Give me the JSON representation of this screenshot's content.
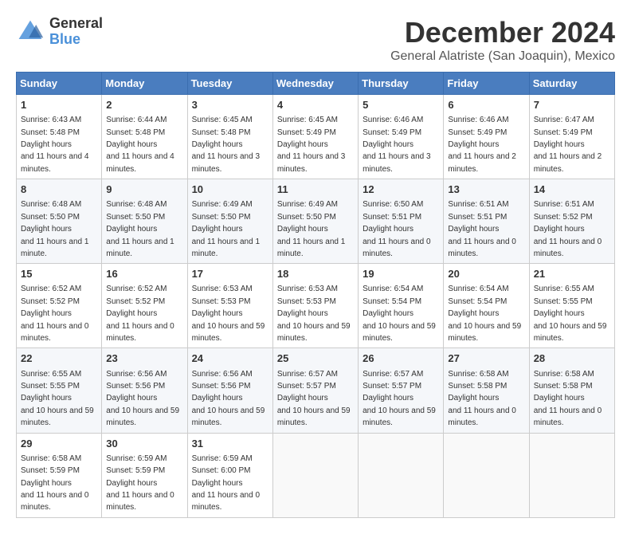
{
  "logo": {
    "general": "General",
    "blue": "Blue"
  },
  "title": {
    "month": "December 2024",
    "location": "General Alatriste (San Joaquin), Mexico"
  },
  "weekdays": [
    "Sunday",
    "Monday",
    "Tuesday",
    "Wednesday",
    "Thursday",
    "Friday",
    "Saturday"
  ],
  "weeks": [
    [
      {
        "day": "1",
        "sunrise": "6:43 AM",
        "sunset": "5:48 PM",
        "daylight": "11 hours and 4 minutes."
      },
      {
        "day": "2",
        "sunrise": "6:44 AM",
        "sunset": "5:48 PM",
        "daylight": "11 hours and 4 minutes."
      },
      {
        "day": "3",
        "sunrise": "6:45 AM",
        "sunset": "5:48 PM",
        "daylight": "11 hours and 3 minutes."
      },
      {
        "day": "4",
        "sunrise": "6:45 AM",
        "sunset": "5:49 PM",
        "daylight": "11 hours and 3 minutes."
      },
      {
        "day": "5",
        "sunrise": "6:46 AM",
        "sunset": "5:49 PM",
        "daylight": "11 hours and 3 minutes."
      },
      {
        "day": "6",
        "sunrise": "6:46 AM",
        "sunset": "5:49 PM",
        "daylight": "11 hours and 2 minutes."
      },
      {
        "day": "7",
        "sunrise": "6:47 AM",
        "sunset": "5:49 PM",
        "daylight": "11 hours and 2 minutes."
      }
    ],
    [
      {
        "day": "8",
        "sunrise": "6:48 AM",
        "sunset": "5:50 PM",
        "daylight": "11 hours and 1 minute."
      },
      {
        "day": "9",
        "sunrise": "6:48 AM",
        "sunset": "5:50 PM",
        "daylight": "11 hours and 1 minute."
      },
      {
        "day": "10",
        "sunrise": "6:49 AM",
        "sunset": "5:50 PM",
        "daylight": "11 hours and 1 minute."
      },
      {
        "day": "11",
        "sunrise": "6:49 AM",
        "sunset": "5:50 PM",
        "daylight": "11 hours and 1 minute."
      },
      {
        "day": "12",
        "sunrise": "6:50 AM",
        "sunset": "5:51 PM",
        "daylight": "11 hours and 0 minutes."
      },
      {
        "day": "13",
        "sunrise": "6:51 AM",
        "sunset": "5:51 PM",
        "daylight": "11 hours and 0 minutes."
      },
      {
        "day": "14",
        "sunrise": "6:51 AM",
        "sunset": "5:52 PM",
        "daylight": "11 hours and 0 minutes."
      }
    ],
    [
      {
        "day": "15",
        "sunrise": "6:52 AM",
        "sunset": "5:52 PM",
        "daylight": "11 hours and 0 minutes."
      },
      {
        "day": "16",
        "sunrise": "6:52 AM",
        "sunset": "5:52 PM",
        "daylight": "11 hours and 0 minutes."
      },
      {
        "day": "17",
        "sunrise": "6:53 AM",
        "sunset": "5:53 PM",
        "daylight": "10 hours and 59 minutes."
      },
      {
        "day": "18",
        "sunrise": "6:53 AM",
        "sunset": "5:53 PM",
        "daylight": "10 hours and 59 minutes."
      },
      {
        "day": "19",
        "sunrise": "6:54 AM",
        "sunset": "5:54 PM",
        "daylight": "10 hours and 59 minutes."
      },
      {
        "day": "20",
        "sunrise": "6:54 AM",
        "sunset": "5:54 PM",
        "daylight": "10 hours and 59 minutes."
      },
      {
        "day": "21",
        "sunrise": "6:55 AM",
        "sunset": "5:55 PM",
        "daylight": "10 hours and 59 minutes."
      }
    ],
    [
      {
        "day": "22",
        "sunrise": "6:55 AM",
        "sunset": "5:55 PM",
        "daylight": "10 hours and 59 minutes."
      },
      {
        "day": "23",
        "sunrise": "6:56 AM",
        "sunset": "5:56 PM",
        "daylight": "10 hours and 59 minutes."
      },
      {
        "day": "24",
        "sunrise": "6:56 AM",
        "sunset": "5:56 PM",
        "daylight": "10 hours and 59 minutes."
      },
      {
        "day": "25",
        "sunrise": "6:57 AM",
        "sunset": "5:57 PM",
        "daylight": "10 hours and 59 minutes."
      },
      {
        "day": "26",
        "sunrise": "6:57 AM",
        "sunset": "5:57 PM",
        "daylight": "10 hours and 59 minutes."
      },
      {
        "day": "27",
        "sunrise": "6:58 AM",
        "sunset": "5:58 PM",
        "daylight": "11 hours and 0 minutes."
      },
      {
        "day": "28",
        "sunrise": "6:58 AM",
        "sunset": "5:58 PM",
        "daylight": "11 hours and 0 minutes."
      }
    ],
    [
      {
        "day": "29",
        "sunrise": "6:58 AM",
        "sunset": "5:59 PM",
        "daylight": "11 hours and 0 minutes."
      },
      {
        "day": "30",
        "sunrise": "6:59 AM",
        "sunset": "5:59 PM",
        "daylight": "11 hours and 0 minutes."
      },
      {
        "day": "31",
        "sunrise": "6:59 AM",
        "sunset": "6:00 PM",
        "daylight": "11 hours and 0 minutes."
      },
      null,
      null,
      null,
      null
    ]
  ],
  "labels": {
    "sunrise": "Sunrise:",
    "sunset": "Sunset:",
    "daylight": "Daylight hours"
  }
}
